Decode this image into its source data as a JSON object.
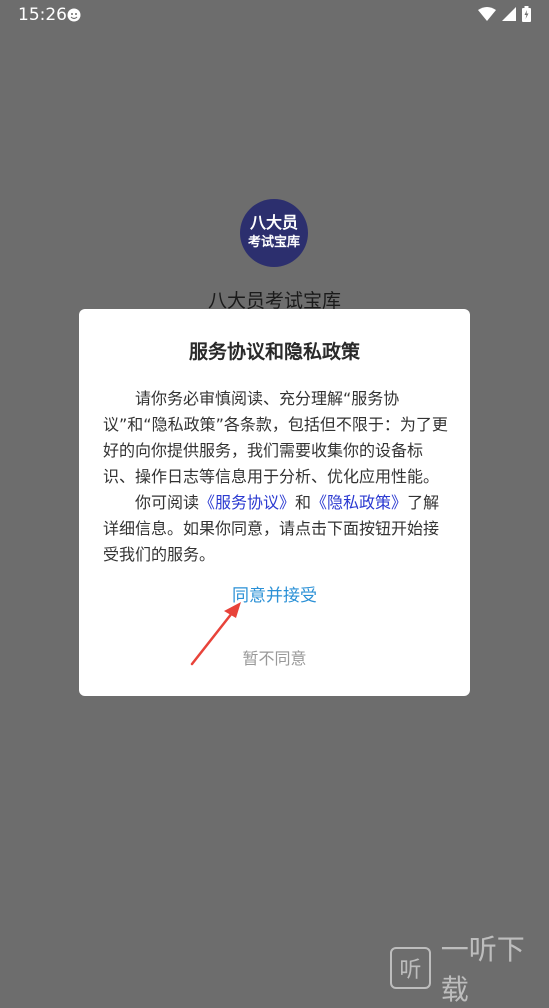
{
  "status_bar": {
    "time": "15:26",
    "icons": [
      "app-notification-icon",
      "wifi-icon",
      "signal-icon",
      "battery-icon"
    ]
  },
  "app": {
    "logo_line1": "八大员",
    "logo_line2": "考试宝库",
    "name": "八大员考试宝库"
  },
  "dialog": {
    "title": "服务协议和隐私政策",
    "paragraph1": "请你务必审慎阅读、充分理解“服务协议”和“隐私政策”各条款，包括但不限于：为了更好的向你提供服务，我们需要收集你的设备标识、操作日志等信息用于分析、优化应用性能。",
    "paragraph2_prefix": "你可阅读",
    "service_link": "《服务协议》",
    "and_text": "和",
    "privacy_link": "《隐私政策》",
    "paragraph2_suffix": "了解详细信息。如果你同意，请点击下面按钮开始接受我们的服务。",
    "agree_label": "同意并接受",
    "disagree_label": "暂不同意"
  },
  "watermark": {
    "logo_glyph": "听",
    "text": "一听下载"
  },
  "colors": {
    "overlay": "#6d6d6d",
    "link": "#2b3ad1",
    "agree": "#2a90d6",
    "arrow": "#e8433a"
  }
}
